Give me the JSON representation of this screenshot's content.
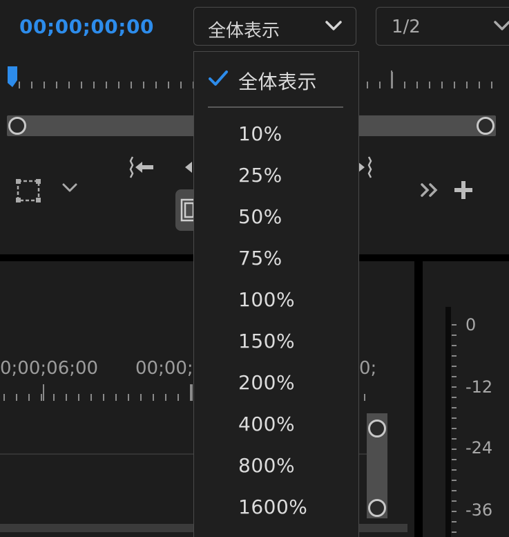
{
  "timecode": "00;00;00;00",
  "zoom_select": {
    "value": "全体表示"
  },
  "resolution_select": {
    "value": "1/2"
  },
  "timeline": {
    "labels": [
      "0;00;06;00",
      "00;00;",
      "0;"
    ]
  },
  "meter": {
    "labels": [
      "0",
      "-12",
      "-24",
      "-36"
    ]
  },
  "zoom_menu": {
    "items": [
      {
        "label": "全体表示",
        "checked": true
      },
      {
        "label": "10%"
      },
      {
        "label": "25%"
      },
      {
        "label": "50%"
      },
      {
        "label": "75%"
      },
      {
        "label": "100%"
      },
      {
        "label": "150%"
      },
      {
        "label": "200%"
      },
      {
        "label": "400%"
      },
      {
        "label": "800%"
      },
      {
        "label": "1600%"
      }
    ]
  },
  "colors": {
    "accent": "#2d8ceb",
    "background": "#1d1d1d",
    "menu_bg": "#1f1f1f"
  },
  "icons": [
    "chevron-down-icon",
    "playhead-icon",
    "mask-icon",
    "step-back-icon",
    "step-forward-icon",
    "more-icon",
    "plus-icon",
    "export-frame-icon",
    "checkmark-icon"
  ]
}
